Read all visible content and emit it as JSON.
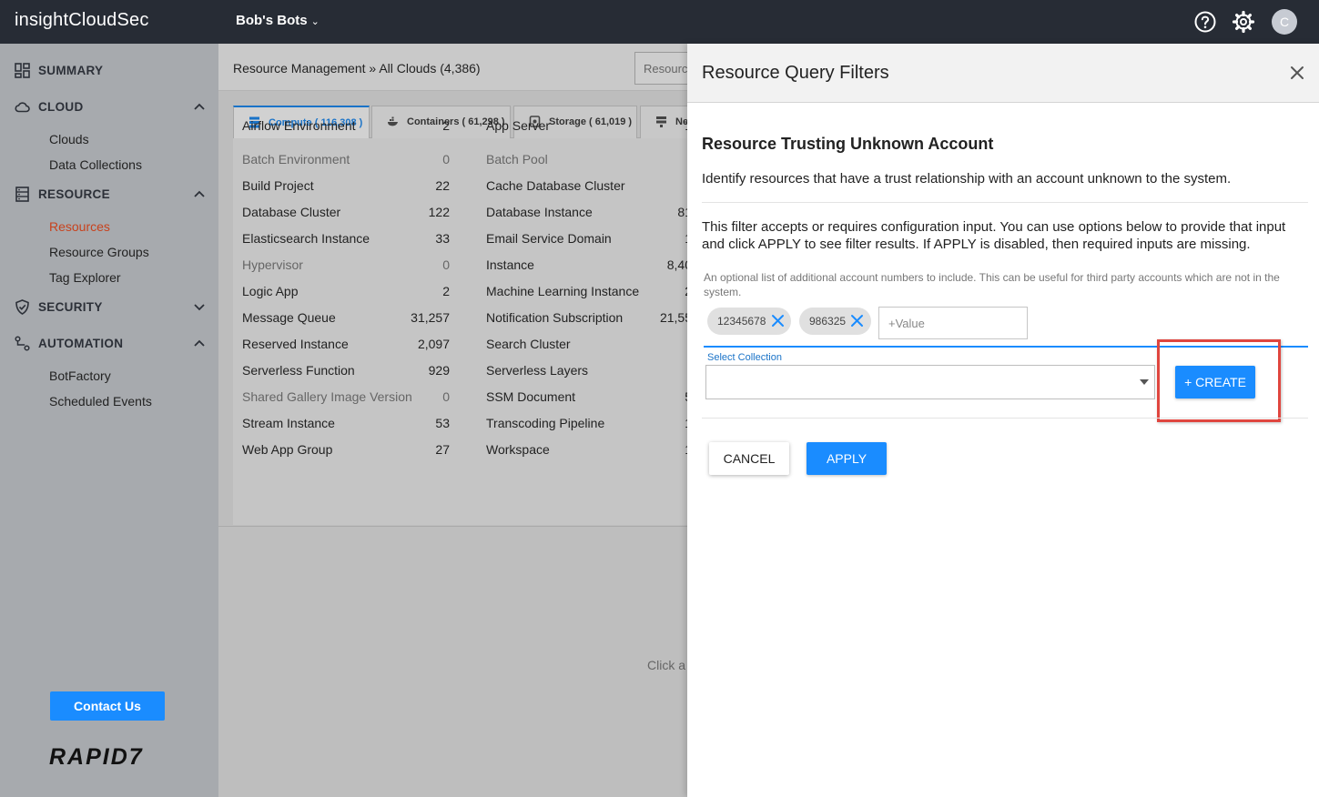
{
  "app": {
    "brand": "insightCloudSec",
    "org_name": "Bob's Bots",
    "avatar_initial": "C"
  },
  "topbar_icons": [
    "help-icon",
    "gear-icon"
  ],
  "sidebar": {
    "sections": [
      {
        "label": "SUMMARY",
        "icon": "dashboard-icon"
      },
      {
        "label": "CLOUD",
        "icon": "cloud-icon",
        "expanded": true,
        "items": [
          "Clouds",
          "Data Collections"
        ]
      },
      {
        "label": "RESOURCE",
        "icon": "resource-icon",
        "expanded": true,
        "items": [
          "Resources",
          "Resource Groups",
          "Tag Explorer"
        ],
        "active_item": "Resources"
      },
      {
        "label": "SECURITY",
        "icon": "shield-icon",
        "expanded": false
      },
      {
        "label": "AUTOMATION",
        "icon": "automation-icon",
        "expanded": true,
        "items": [
          "BotFactory",
          "Scheduled Events"
        ]
      }
    ],
    "contact_label": "Contact Us",
    "logo_text": "RAPID7"
  },
  "main": {
    "breadcrumb": "Resource Management » All Clouds (4,386)",
    "search_placeholder": "Resource",
    "tabs": [
      {
        "label": "Compute ( 116,308 )",
        "icon": "server-icon",
        "active": true
      },
      {
        "label": "Containers ( 61,298 )",
        "icon": "containers-icon"
      },
      {
        "label": "Storage ( 61,019 )",
        "icon": "storage-icon"
      },
      {
        "label": "Ne",
        "icon": "network-icon"
      }
    ],
    "left_column": [
      {
        "name": "Airflow Environment",
        "count": "2"
      },
      {
        "name": "Batch Environment",
        "count": "0",
        "dim": true
      },
      {
        "name": "Build Project",
        "count": "22"
      },
      {
        "name": "Database Cluster",
        "count": "122"
      },
      {
        "name": "Elasticsearch Instance",
        "count": "33"
      },
      {
        "name": "Hypervisor",
        "count": "0",
        "dim": true
      },
      {
        "name": "Logic App",
        "count": "2"
      },
      {
        "name": "Message Queue",
        "count": "31,257"
      },
      {
        "name": "Reserved Instance",
        "count": "2,097"
      },
      {
        "name": "Serverless Function",
        "count": "929"
      },
      {
        "name": "Shared Gallery Image Version",
        "count": "0",
        "dim": true
      },
      {
        "name": "Stream Instance",
        "count": "53"
      },
      {
        "name": "Web App Group",
        "count": "27"
      }
    ],
    "right_column": [
      {
        "name": "App Server",
        "count": "1"
      },
      {
        "name": "Batch Pool",
        "count": "",
        "dim": true
      },
      {
        "name": "Cache Database Cluster",
        "count": ""
      },
      {
        "name": "Database Instance",
        "count": "81"
      },
      {
        "name": "Email Service Domain",
        "count": "1"
      },
      {
        "name": "Instance",
        "count": "8,40"
      },
      {
        "name": "Machine Learning Instance",
        "count": "2"
      },
      {
        "name": "Notification Subscription",
        "count": "21,55"
      },
      {
        "name": "Search Cluster",
        "count": ""
      },
      {
        "name": "Serverless Layers",
        "count": ""
      },
      {
        "name": "SSM Document",
        "count": "5"
      },
      {
        "name": "Transcoding Pipeline",
        "count": "1"
      },
      {
        "name": "Workspace",
        "count": "1"
      }
    ],
    "click_hint": "Click a"
  },
  "drawer": {
    "title": "Resource Query Filters",
    "filter_title": "Resource Trusting Unknown Account",
    "filter_description": "Identify resources that have a trust relationship with an account unknown to the system.",
    "config_text": "This filter accepts or requires configuration input. You can use options below to provide that input and click APPLY to see filter results. If APPLY is disabled, then required inputs are missing.",
    "optional_help": "An optional list of additional account numbers to include. This can be useful for third party accounts which are not in the system.",
    "chips": [
      "12345678",
      "986325"
    ],
    "value_placeholder": "+Value",
    "select_label": "Select Collection",
    "create_label": "+ CREATE",
    "cancel_label": "CANCEL",
    "apply_label": "APPLY",
    "highlight_color": "#e0463f"
  },
  "colors": {
    "accent": "#1a8cff",
    "active_nav": "#c8421d",
    "topbar": "#272c35"
  }
}
